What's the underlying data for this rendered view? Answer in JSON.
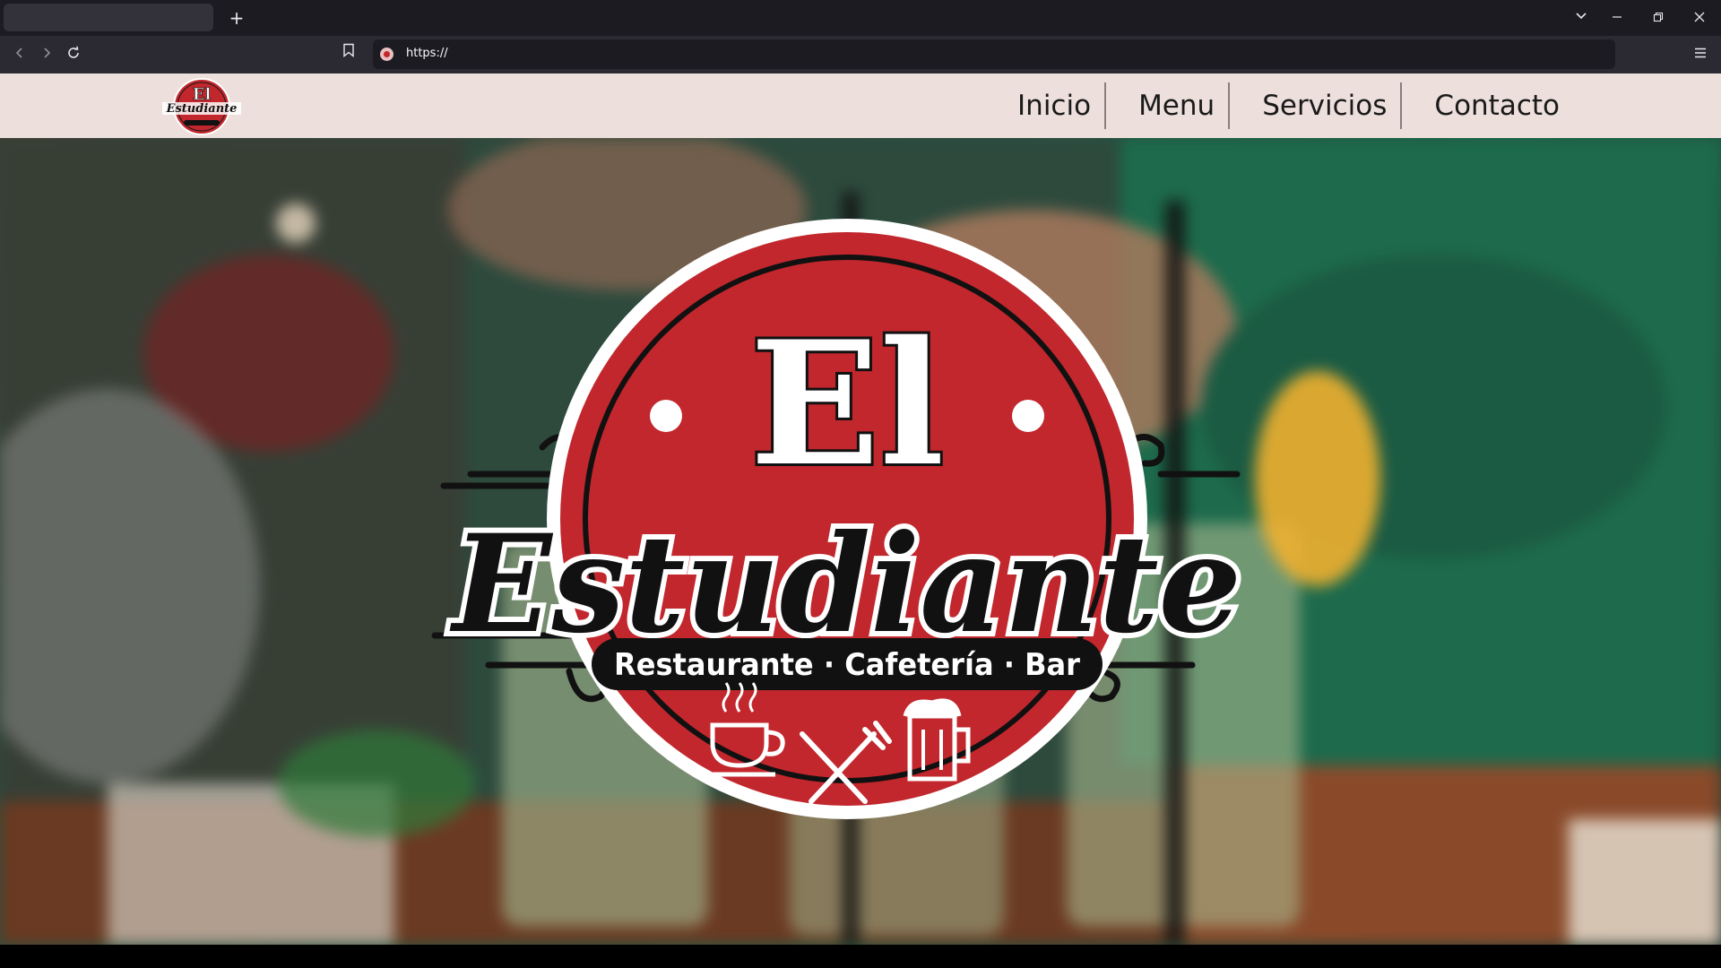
{
  "browser": {
    "new_tab_icon": "plus-icon",
    "url": "https://",
    "window_controls": [
      "list-tabs-icon",
      "minimize-icon",
      "restore-icon",
      "close-icon"
    ]
  },
  "site": {
    "nav": [
      {
        "label": "Inicio"
      },
      {
        "label": "Menu"
      },
      {
        "label": "Servicios"
      },
      {
        "label": "Contacto"
      }
    ],
    "logo": {
      "title_top": "El",
      "title_main": "Estudiante",
      "tagline": "Restaurante · Cafetería · Bar",
      "icons": [
        "coffee-cup-icon",
        "fork-knife-icon",
        "beer-mug-icon"
      ]
    },
    "colors": {
      "logo_red": "#c1272d",
      "header_bg": "#ede0dc",
      "hero_green": "#1f5a44"
    }
  }
}
